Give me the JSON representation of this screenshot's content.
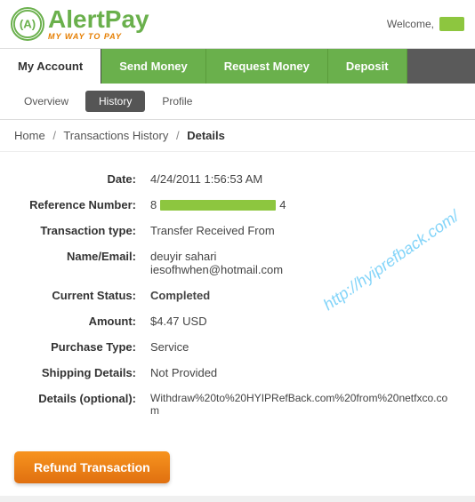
{
  "header": {
    "logo_main": "AlertPay",
    "logo_icon": "A",
    "logo_tagline": "MY WAY TO PAY",
    "welcome_text": "Welcome,"
  },
  "main_nav": {
    "items": [
      {
        "label": "My Account",
        "active": true
      },
      {
        "label": "Send Money",
        "active": false
      },
      {
        "label": "Request Money",
        "active": false
      },
      {
        "label": "Deposit",
        "active": false
      }
    ]
  },
  "sub_nav": {
    "items": [
      {
        "label": "Overview",
        "active": false
      },
      {
        "label": "History",
        "active": true
      },
      {
        "label": "Profile",
        "active": false
      }
    ]
  },
  "breadcrumb": {
    "home": "Home",
    "separator1": "/",
    "section": "Transactions History",
    "separator2": "/",
    "current": "Details"
  },
  "details": {
    "date_label": "Date:",
    "date_value": "4/24/2011 1:56:53 AM",
    "ref_label": "Reference Number:",
    "ref_start": "8",
    "ref_end": "4",
    "txn_type_label": "Transaction type:",
    "txn_type_value": "Transfer Received From",
    "name_email_label": "Name/Email:",
    "name_value": "deuyir sahari",
    "email_value": "iesofhwhen@hotmail.com",
    "status_label": "Current Status:",
    "status_value": "Completed",
    "amount_label": "Amount:",
    "amount_value": "$4.47 USD",
    "purchase_label": "Purchase Type:",
    "purchase_value": "Service",
    "shipping_label": "Shipping Details:",
    "shipping_value": "Not Provided",
    "details_label": "Details (optional):",
    "details_value": "Withdraw%20to%20HYIPRefBack.com%20from%20netfxco.com"
  },
  "watermark": {
    "text": "http://hyiprefback.com/"
  },
  "buttons": {
    "refund": "Refund Transaction"
  }
}
